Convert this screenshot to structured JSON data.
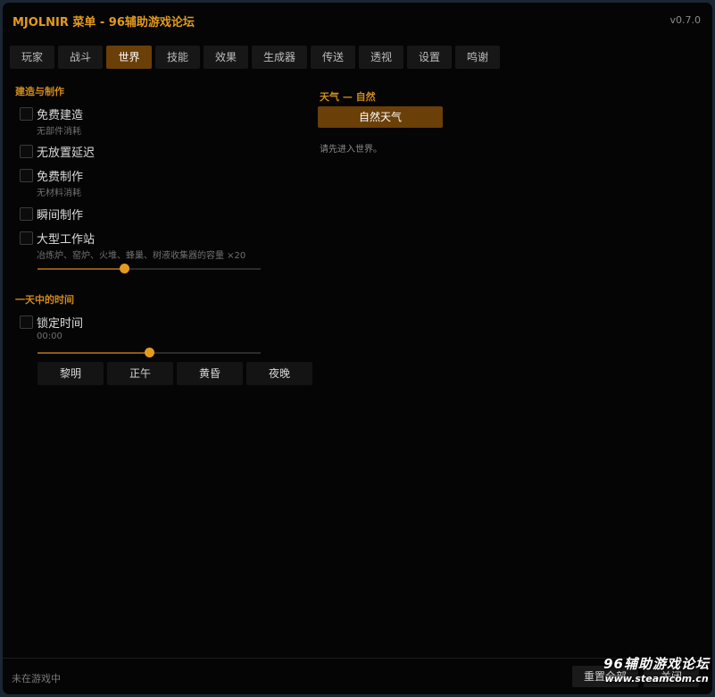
{
  "window": {
    "title": "MJOLNIR 菜单 - 96辅助游戏论坛",
    "version": "v0.7.0"
  },
  "tabs": [
    {
      "label": "玩家",
      "active": false
    },
    {
      "label": "战斗",
      "active": false
    },
    {
      "label": "世界",
      "active": true
    },
    {
      "label": "技能",
      "active": false
    },
    {
      "label": "效果",
      "active": false
    },
    {
      "label": "生成器",
      "active": false
    },
    {
      "label": "传送",
      "active": false
    },
    {
      "label": "透视",
      "active": false
    },
    {
      "label": "设置",
      "active": false
    },
    {
      "label": "鸣谢",
      "active": false
    }
  ],
  "build": {
    "title": "建造与制作",
    "options": [
      {
        "label": "免费建造",
        "sub": "无部件消耗",
        "checked": false
      },
      {
        "label": "无放置延迟",
        "sub": "",
        "checked": false
      },
      {
        "label": "免费制作",
        "sub": "无材料消耗",
        "checked": false
      },
      {
        "label": "瞬间制作",
        "sub": "",
        "checked": false
      },
      {
        "label": "大型工作站",
        "sub": "冶炼炉、窑炉、火堆、蜂巢、树液收集器的容量 ×20",
        "checked": false
      }
    ],
    "capacity_slider_fraction": 0.39
  },
  "time": {
    "title": "一天中的时间",
    "lock_label": "锁定时间",
    "lock_checked": false,
    "value": "00:00",
    "slider_fraction": 0.5,
    "buttons": [
      "黎明",
      "正午",
      "黄昏",
      "夜晚"
    ]
  },
  "weather": {
    "title": "天气 — 自然",
    "button": "自然天气",
    "hint": "请先进入世界。"
  },
  "footer": {
    "status": "未在游戏中",
    "reset_label": "重置全部",
    "close_label": "关闭"
  },
  "watermark": {
    "line1": "96辅助游戏论坛",
    "line2": "www.steamcom.cn"
  },
  "colors": {
    "accent": "#e39b1e",
    "active_tab": "#6a3f08",
    "background": "#050505"
  }
}
